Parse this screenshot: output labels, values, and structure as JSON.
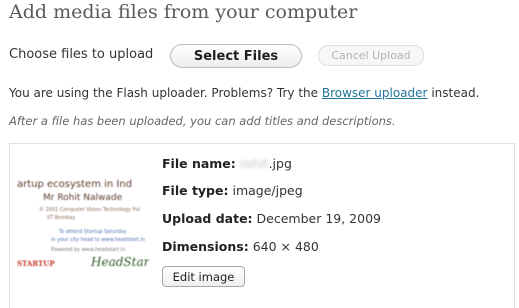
{
  "page": {
    "title": "Add media files from your computer"
  },
  "uploader": {
    "choose_label": "Choose files to upload",
    "select_button": "Select Files",
    "cancel_button": "Cancel Upload"
  },
  "flash_notice": {
    "before": "You are using the Flash uploader. Problems? Try the ",
    "link": "Browser uploader",
    "after": " instead."
  },
  "hint": "After a file has been uploaded, you can add titles and descriptions.",
  "media": {
    "thumbnail": {
      "line1": "artup ecosystem in Ind",
      "line2": "Mr Rohit Nalwade",
      "line3": "© 2001 Computer Vision Technology Pvt",
      "line4": "IIT Bombay",
      "line5": "To attend Startup Saturday",
      "line6": "in your city head to www.headstart.in",
      "line7": "Powered by www.headstart.in",
      "logo_left": "STARTUP",
      "logo_right": "HeadStart"
    },
    "file_name": {
      "label": "File name:",
      "name_blurred": "rohit",
      "extension": ".jpg"
    },
    "file_type": {
      "label": "File type:",
      "value": "image/jpeg"
    },
    "upload_date": {
      "label": "Upload date:",
      "value": "December 19, 2009"
    },
    "dimensions": {
      "label": "Dimensions:",
      "value": "640 × 480"
    },
    "edit_button": "Edit image"
  }
}
